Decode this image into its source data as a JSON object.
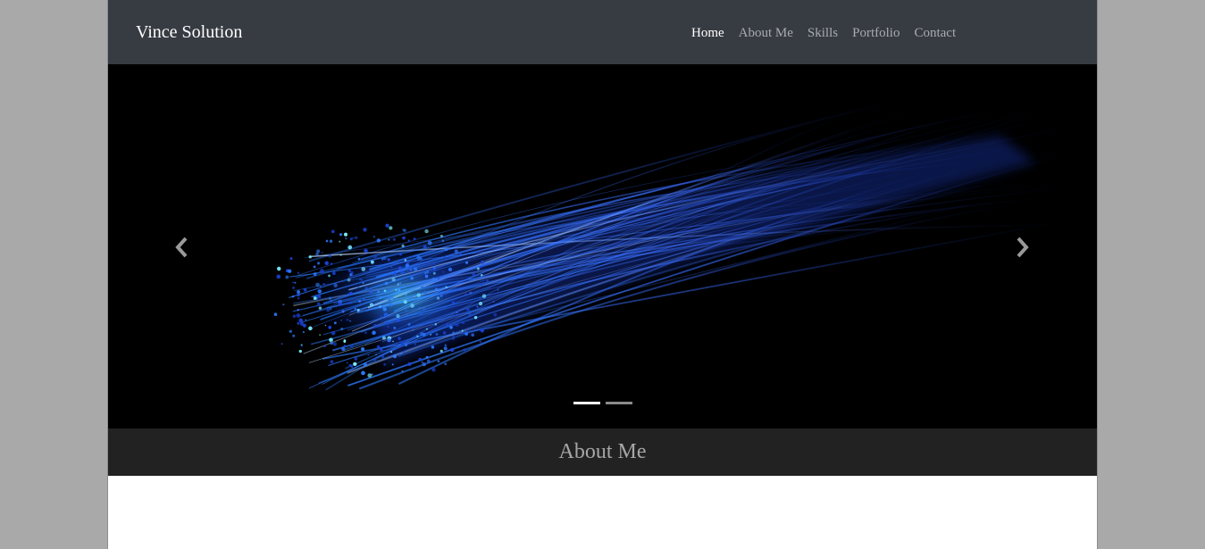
{
  "navbar": {
    "brand": "Vince Solution",
    "items": [
      {
        "label": "Home",
        "active": true
      },
      {
        "label": "About Me",
        "active": false
      },
      {
        "label": "Skills",
        "active": false
      },
      {
        "label": "Portfolio",
        "active": false
      },
      {
        "label": "Contact",
        "active": false
      }
    ]
  },
  "carousel": {
    "prev_icon": "chevron-left-icon",
    "next_icon": "chevron-right-icon",
    "slide_count": 2,
    "active_slide": 1,
    "slide_subject": "blue fiber optic strands on black background"
  },
  "about_section": {
    "heading": "About Me"
  },
  "colors": {
    "navbar_bg": "#373b42",
    "section_bar_bg": "#222222",
    "outer_bg": "#a9a9a9",
    "fiber_blue": "#1e5bff"
  }
}
